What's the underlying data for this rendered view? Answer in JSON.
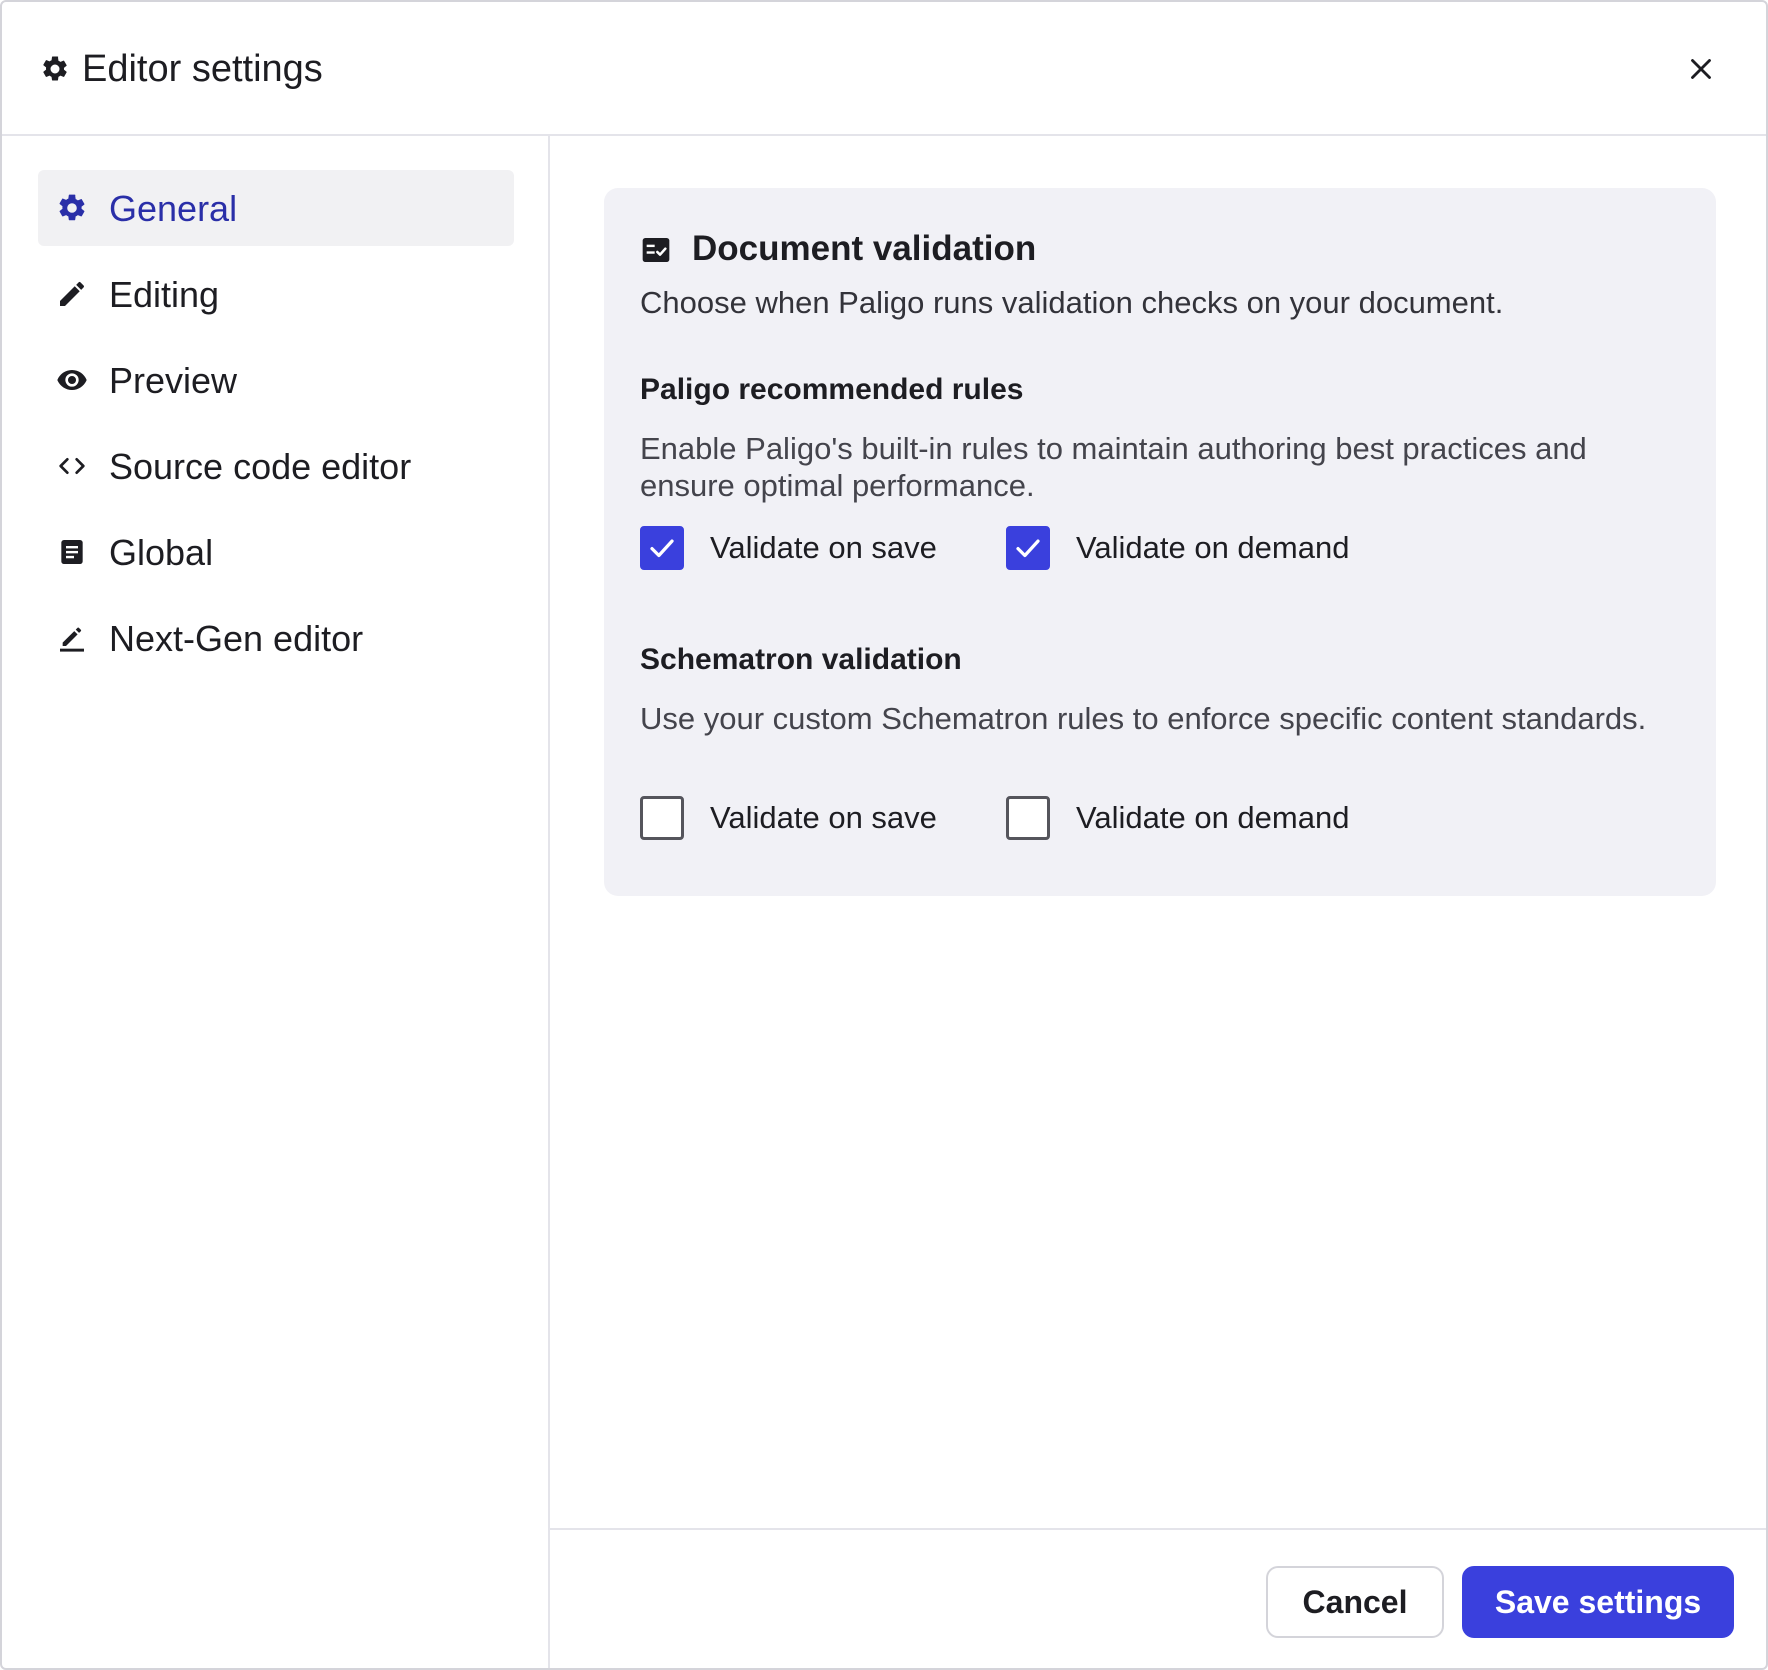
{
  "dialog": {
    "title": "Editor settings",
    "header_icon": "gear-icon",
    "close_icon": "close-icon"
  },
  "sidebar": {
    "items": [
      {
        "label": "General",
        "icon": "gear-icon",
        "active": true
      },
      {
        "label": "Editing",
        "icon": "pencil-icon",
        "active": false
      },
      {
        "label": "Preview",
        "icon": "eye-icon",
        "active": false
      },
      {
        "label": "Source code editor",
        "icon": "code-icon",
        "active": false
      },
      {
        "label": "Global",
        "icon": "document-icon",
        "active": false
      },
      {
        "label": "Next-Gen editor",
        "icon": "pen-underline-icon",
        "active": false
      }
    ]
  },
  "card": {
    "icon": "checklist-icon",
    "title": "Document validation",
    "description": "Choose when Paligo runs validation checks on your document.",
    "sections": [
      {
        "title": "Paligo recommended rules",
        "description": "Enable Paligo's built-in rules to maintain authoring best practices and ensure optimal performance.",
        "options": [
          {
            "label": "Validate on save",
            "checked": true
          },
          {
            "label": "Validate on demand",
            "checked": true
          }
        ]
      },
      {
        "title": "Schematron validation",
        "description": "Use your custom Schematron rules to enforce specific content standards.",
        "options": [
          {
            "label": "Validate on save",
            "checked": false
          },
          {
            "label": "Validate on demand",
            "checked": false
          }
        ]
      }
    ]
  },
  "footer": {
    "cancel_label": "Cancel",
    "save_label": "Save settings"
  },
  "colors": {
    "accent": "#3a40dd",
    "active_nav_text": "#2a2fa8",
    "active_nav_bg": "#f1f1f3",
    "card_bg": "#f1f1f6"
  }
}
